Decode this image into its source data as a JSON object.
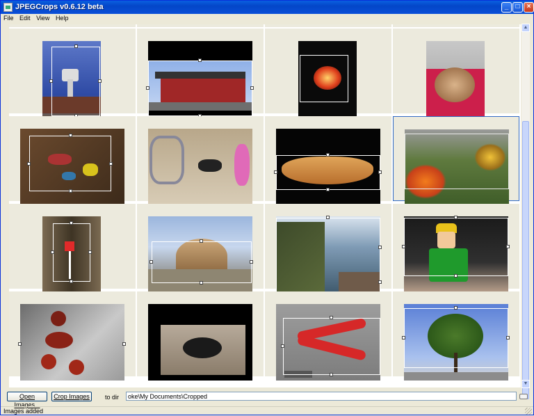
{
  "window": {
    "title": "JPEGCrops v0.6.12 beta",
    "minimize": "_",
    "maximize": "□",
    "close": "×"
  },
  "menu": [
    "File",
    "Edit",
    "View",
    "Help"
  ],
  "thumbnails": [
    {
      "name": "photo-water-tower"
    },
    {
      "name": "photo-red-house"
    },
    {
      "name": "photo-pumpkin-lantern"
    },
    {
      "name": "photo-stuffed-monkey"
    },
    {
      "name": "photo-toys-on-floor"
    },
    {
      "name": "photo-child-and-dog"
    },
    {
      "name": "photo-banana"
    },
    {
      "name": "photo-flower-garden"
    },
    {
      "name": "photo-candle"
    },
    {
      "name": "photo-rock-formation"
    },
    {
      "name": "photo-coastal-cliffs"
    },
    {
      "name": "photo-toy-figure"
    },
    {
      "name": "photo-chestnut-figure"
    },
    {
      "name": "photo-black-lamb"
    },
    {
      "name": "photo-pliers"
    },
    {
      "name": "photo-tree"
    }
  ],
  "toolbar": {
    "open_label": "Open Images...",
    "crop_label": "Crop Images",
    "to_dir_label": "to dir",
    "path_value": "oke\\My Documents\\Cropped"
  },
  "status": {
    "text": "Images added"
  },
  "colors": {
    "title_bar": "#0a4fd8",
    "selection": "#316ac5",
    "cell_bg": "#eceadd"
  }
}
